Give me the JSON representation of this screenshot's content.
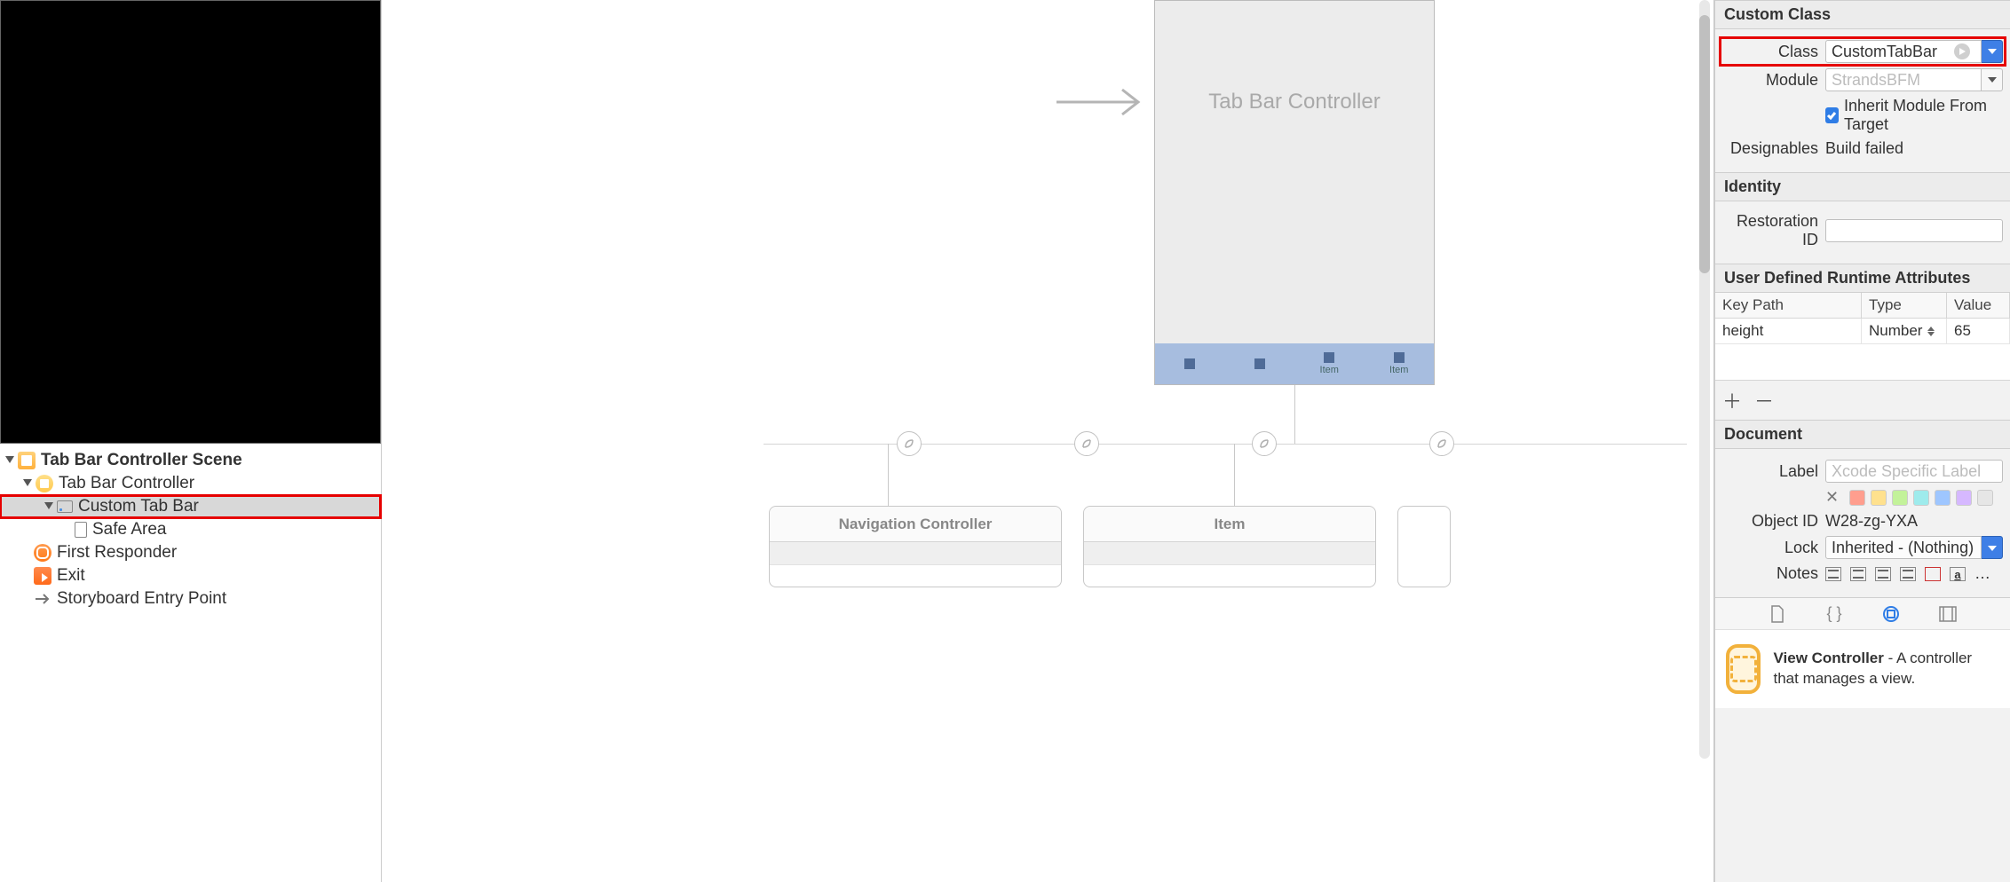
{
  "outline": {
    "scene": "Tab Bar Controller Scene",
    "controller": "Tab Bar Controller",
    "custom_bar": "Custom Tab Bar",
    "safe_area": "Safe Area",
    "first_responder": "First Responder",
    "exit": "Exit",
    "entry": "Storyboard Entry Point"
  },
  "canvas": {
    "device_title": "Tab Bar Controller",
    "tab_item": "Item",
    "child1": "Navigation Controller",
    "child2": "Item"
  },
  "inspector": {
    "custom_class": {
      "title": "Custom Class",
      "class_label": "Class",
      "class_value": "CustomTabBar",
      "module_label": "Module",
      "module_placeholder": "StrandsBFM",
      "inherit_label": "Inherit Module From Target",
      "designables_label": "Designables",
      "designables_value": "Build failed"
    },
    "identity": {
      "title": "Identity",
      "restoration_label": "Restoration ID"
    },
    "runtime": {
      "title": "User Defined Runtime Attributes",
      "col_key": "Key Path",
      "col_type": "Type",
      "col_value": "Value",
      "row_key": "height",
      "row_type": "Number",
      "row_value": "65"
    },
    "document": {
      "title": "Document",
      "label_label": "Label",
      "label_placeholder": "Xcode Specific Label",
      "objectid_label": "Object ID",
      "objectid_value": "W28-zg-YXA",
      "lock_label": "Lock",
      "lock_value": "Inherited - (Nothing)",
      "notes_label": "Notes",
      "swatch_colors": [
        "#ff9e8e",
        "#ffe18e",
        "#c3f29a",
        "#9eebec",
        "#9ec6ff",
        "#d6b8ff",
        "#e6e6e6"
      ]
    },
    "library": {
      "item_title": "View Controller",
      "item_desc": " - A controller that manages a view."
    }
  }
}
